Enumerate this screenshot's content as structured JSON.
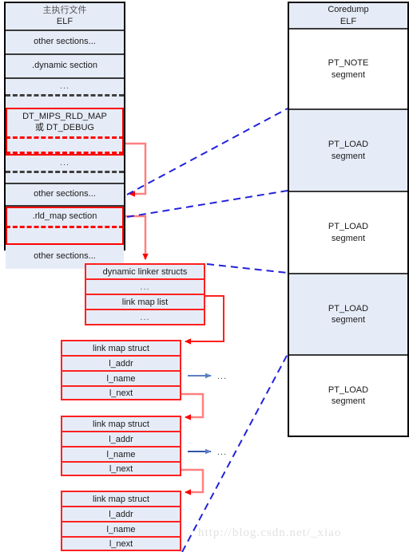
{
  "colors": {
    "box_fill": "#e6ecf7",
    "panel_border": "#3a3a3a",
    "struct_red": "#ff2020",
    "link_blue": "#2222dd",
    "pointer_blue": "#5b7fc4",
    "watermark": "#e2e2e2"
  },
  "executable_panel": {
    "name": "main-executable-elf",
    "title_line1": "主执行文件",
    "title_line2": "ELF",
    "rows": [
      {
        "label": "other sections...",
        "kind": "plain"
      },
      {
        "label": ".dynamic section",
        "kind": "plain"
      },
      {
        "label": "...",
        "kind": "ellipsis-dashed"
      },
      {
        "label": "",
        "kind": "spacer"
      },
      {
        "label": "DT_MIPS_RLD_MAP\n或 DT_DEBUG",
        "kind": "red-highlight"
      },
      {
        "label": "",
        "kind": "red-dashed-spacer"
      },
      {
        "label": "...",
        "kind": "ellipsis-dashed"
      },
      {
        "label": "",
        "kind": "spacer"
      },
      {
        "label": "other sections...",
        "kind": "plain"
      },
      {
        "label": ".rld_map section",
        "kind": "red-highlight"
      },
      {
        "label": "",
        "kind": "red-dashed-spacer"
      },
      {
        "label": "other sections...",
        "kind": "plain"
      }
    ]
  },
  "coredump_panel": {
    "name": "coredump-elf",
    "title_line1": "Coredump",
    "title_line2": "ELF",
    "segments": [
      {
        "label": "PT_NOTE\nsegment",
        "shaded": false
      },
      {
        "label": "PT_LOAD\nsegment",
        "shaded": true
      },
      {
        "label": "PT_LOAD\nsegment",
        "shaded": false
      },
      {
        "label": "PT_LOAD\nsegment",
        "shaded": true
      },
      {
        "label": "PT_LOAD\nsegment",
        "shaded": false
      }
    ]
  },
  "dynamic_linker_structs": {
    "name": "dynamic-linker-structs",
    "rows": [
      "dynamic linker structs",
      "...",
      "link map list",
      "..."
    ]
  },
  "link_map_structs": [
    {
      "title": "link map struct",
      "fields": [
        "l_addr",
        "l_name",
        "l_next"
      ],
      "name_pointer_label": "..."
    },
    {
      "title": "link map struct",
      "fields": [
        "l_addr",
        "l_name",
        "l_next"
      ],
      "name_pointer_label": "..."
    },
    {
      "title": "link map struct",
      "fields": [
        "l_addr",
        "l_name",
        "l_next"
      ],
      "name_pointer_label": ""
    }
  ],
  "watermark": {
    "text": "http://blog.csdn.net/_xiao"
  }
}
